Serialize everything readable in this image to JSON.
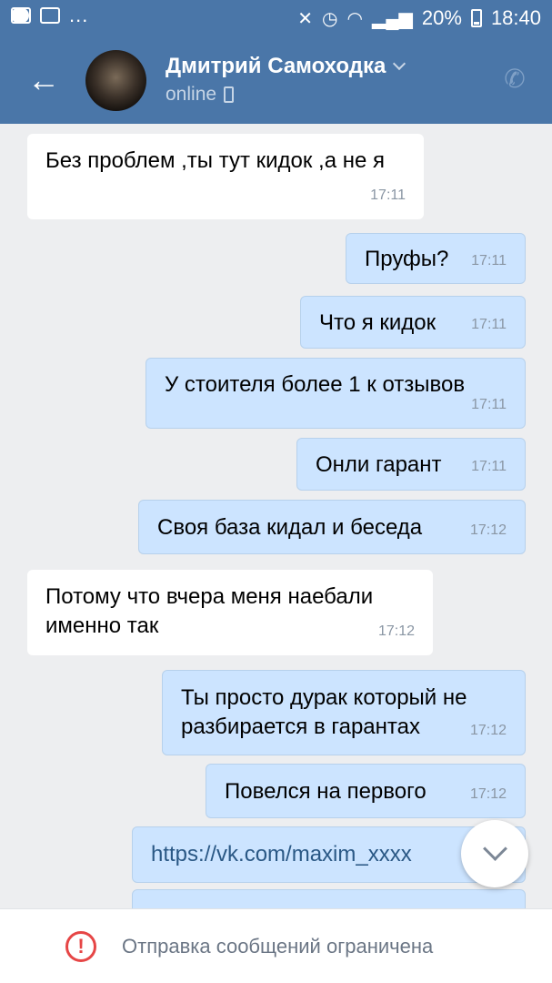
{
  "statusbar": {
    "battery": "20%",
    "time": "18:40",
    "dots": "..."
  },
  "header": {
    "name": "Дмитрий Самоходка",
    "status": "online"
  },
  "messages": [
    {
      "dir": "in",
      "text": "Без проблем ,ты тут кидок ,а не я",
      "time": "17:11"
    },
    {
      "dir": "out",
      "text": "Пруфы?",
      "time": "17:11"
    },
    {
      "dir": "out",
      "text": "Что я кидок",
      "time": "17:11"
    },
    {
      "dir": "out",
      "text": "У стоителя более 1 к отзывов",
      "time": "17:11"
    },
    {
      "dir": "out",
      "text": "Онли гарант",
      "time": "17:11"
    },
    {
      "dir": "out",
      "text": "Своя база кидал и беседа",
      "time": "17:12"
    },
    {
      "dir": "in",
      "text": "Потому что вчера меня наебали именно так",
      "time": "17:12"
    },
    {
      "dir": "out",
      "text": "Ты просто дурак который не разбирается в гарантах",
      "time": "17:12"
    },
    {
      "dir": "out",
      "text": "Повелся на первого",
      "time": "17:12"
    },
    {
      "dir": "out",
      "text": "https://vk.com/maxim_xxxx",
      "time": ""
    }
  ],
  "footer": {
    "text": "Отправка сообщений ограничена"
  },
  "colors": {
    "header": "#4a76a8",
    "outgoing": "#cce4ff",
    "incoming": "#ffffff",
    "link": "#2a5885",
    "warning": "#e64646"
  }
}
